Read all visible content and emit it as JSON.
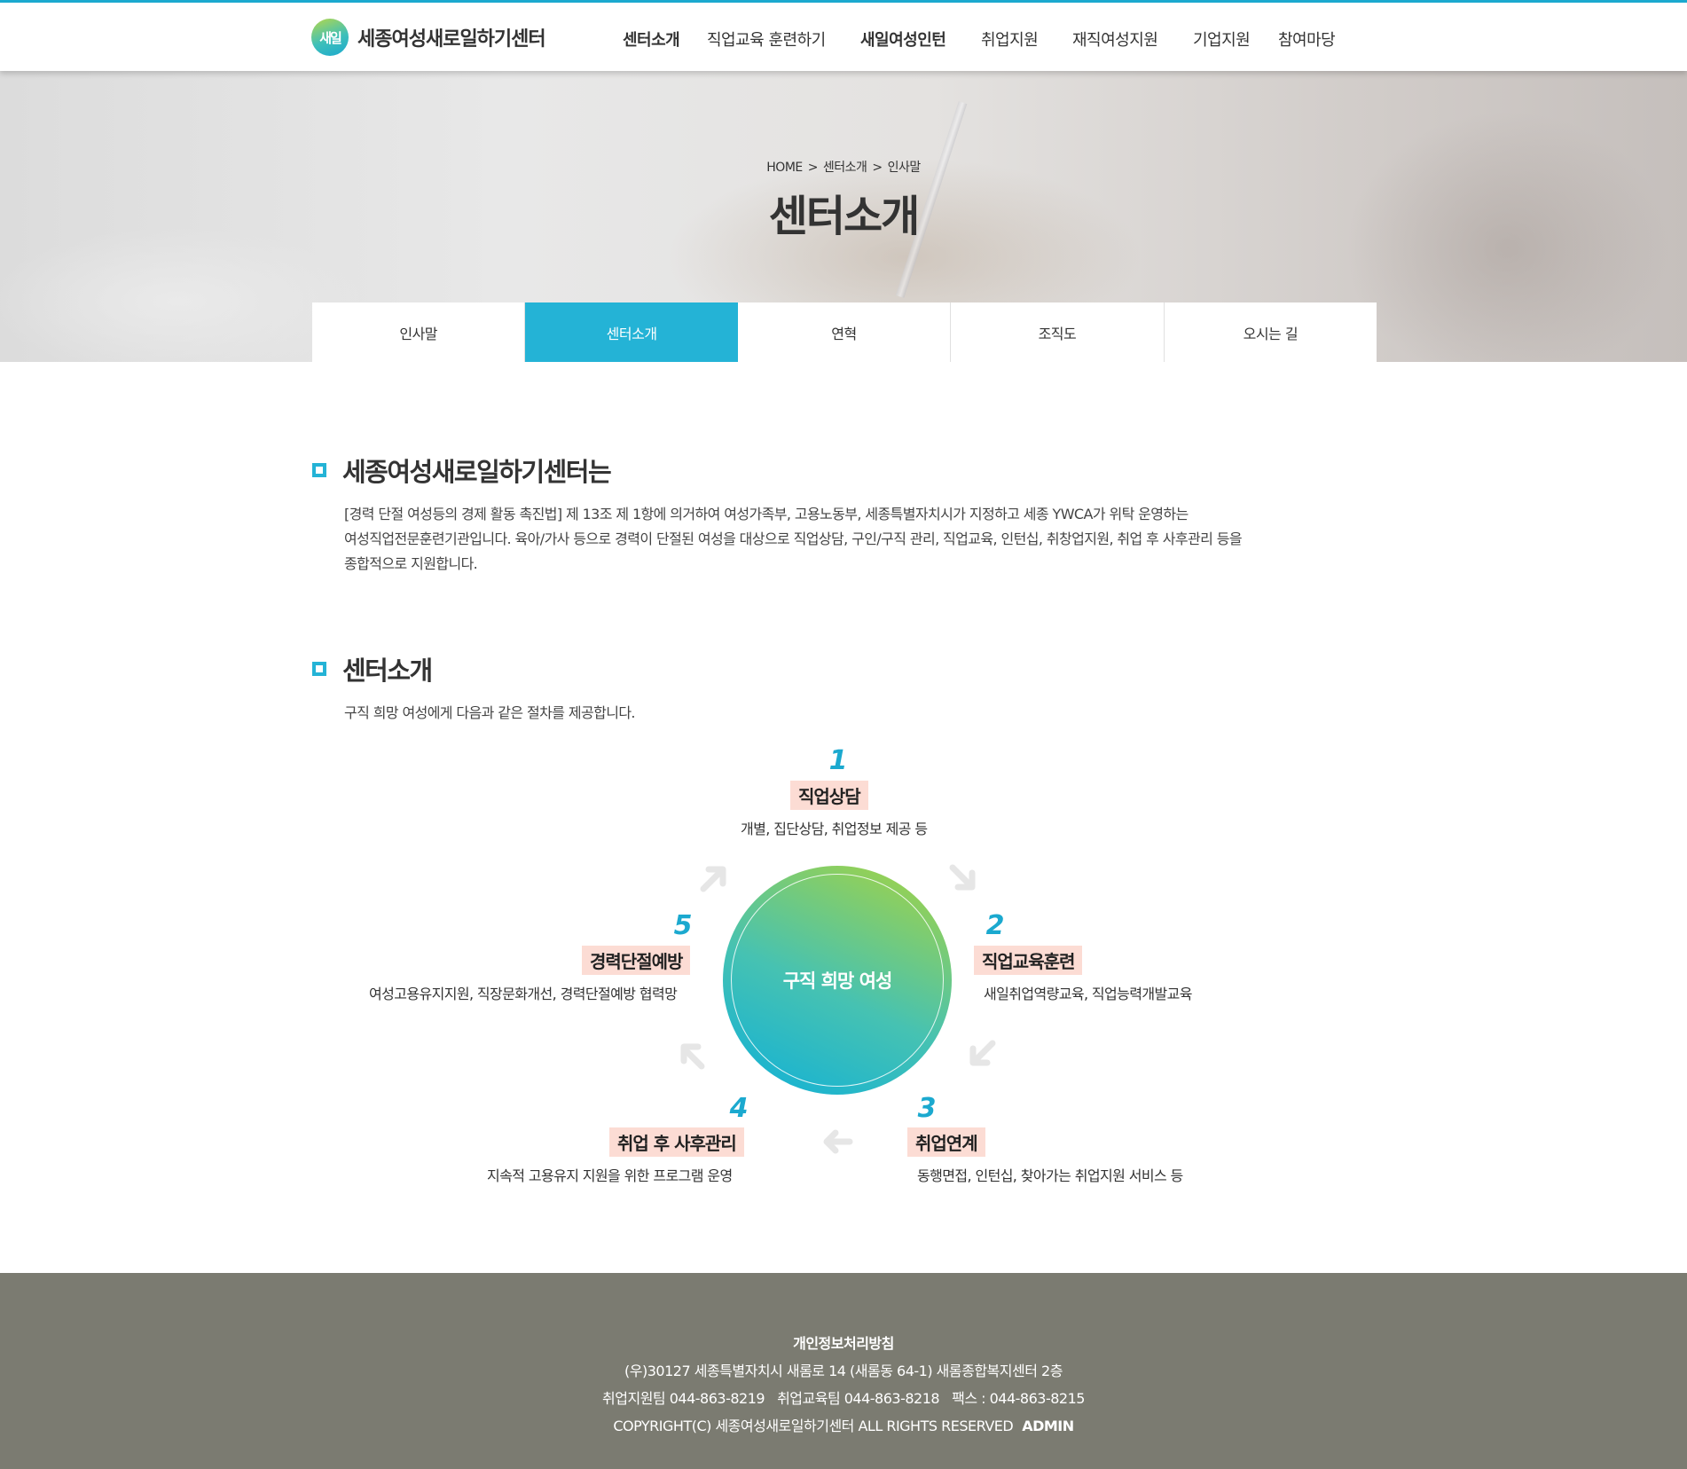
{
  "header": {
    "logo_mark": "새일",
    "logo_text": "세종여성새로일하기센터",
    "nav": [
      {
        "label": "센터소개",
        "bold": true
      },
      {
        "label": "직업교육 훈련하기",
        "bold": false
      },
      {
        "label": "새일여성인턴",
        "bold": true
      },
      {
        "label": "취업지원",
        "bold": false
      },
      {
        "label": "재직여성지원",
        "bold": false
      },
      {
        "label": "기업지원",
        "bold": false
      },
      {
        "label": "참여마당",
        "bold": false
      }
    ]
  },
  "visual": {
    "breadcrumb": {
      "home": "HOME",
      "sep": ">",
      "level1": "센터소개",
      "level2": "인사말"
    },
    "title": "센터소개"
  },
  "subtabs": [
    {
      "label": "인사말",
      "active": false
    },
    {
      "label": "센터소개",
      "active": true
    },
    {
      "label": "연혁",
      "active": false
    },
    {
      "label": "조직도",
      "active": false
    },
    {
      "label": "오시는 길",
      "active": false
    }
  ],
  "section1": {
    "title": "세종여성새로일하기센터는",
    "lines": [
      "[경력 단절 여성등의 경제 활동 촉진법] 제 13조 제 1항에 의거하여 여성가족부, 고용노동부, 세종특별자치시가 지정하고 세종 YWCA가 위탁 운영하는",
      "여성직업전문훈련기관입니다. 육아/가사 등으로 경력이 단절된 여성을 대상으로 직업상담, 구인/구직 관리, 직업교육, 인턴십, 취창업지원, 취업 후 사후관리 등을",
      "종합적으로 지원합니다."
    ]
  },
  "section2": {
    "title": "센터소개",
    "intro": "구직 희망 여성에게 다음과 같은 절차를 제공합니다."
  },
  "diagram": {
    "center": "구직 희망 여성",
    "steps": [
      {
        "num": "1",
        "label": "직업상담",
        "desc": "개별, 집단상담, 취업정보 제공 등"
      },
      {
        "num": "2",
        "label": "직업교육훈련",
        "desc": "새일취업역량교육, 직업능력개발교육"
      },
      {
        "num": "3",
        "label": "취업연계",
        "desc": "동행면접, 인턴십, 찾아가는 취업지원 서비스 등"
      },
      {
        "num": "4",
        "label": "취업 후 사후관리",
        "desc": "지속적 고용유지 지원을 위한 프로그램 운영"
      },
      {
        "num": "5",
        "label": "경력단절예방",
        "desc": "여성고용유지지원, 직장문화개선, 경력단절예방 협력망"
      }
    ],
    "arrow_color": "#e6e6e6"
  },
  "footer": {
    "privacy": "개인정보처리방침",
    "address": "(우)30127 세종특별자치시 새롬로 14 (새롬동 64-1) 새롬종합복지센터 2층",
    "phone1": "취업지원팀 044-863-8219",
    "phone2": "취업교육팀 044-863-8218",
    "fax": "팩스 : 044-863-8215",
    "copyright": "COPYRIGHT(C) 세종여성새로일하기센터 ALL RIGHTS RESERVED",
    "admin": "ADMIN"
  },
  "colors": {
    "accent": "#24b3d6",
    "label_bg": "#fcdcd4",
    "footer_bg": "#7b7b71"
  }
}
